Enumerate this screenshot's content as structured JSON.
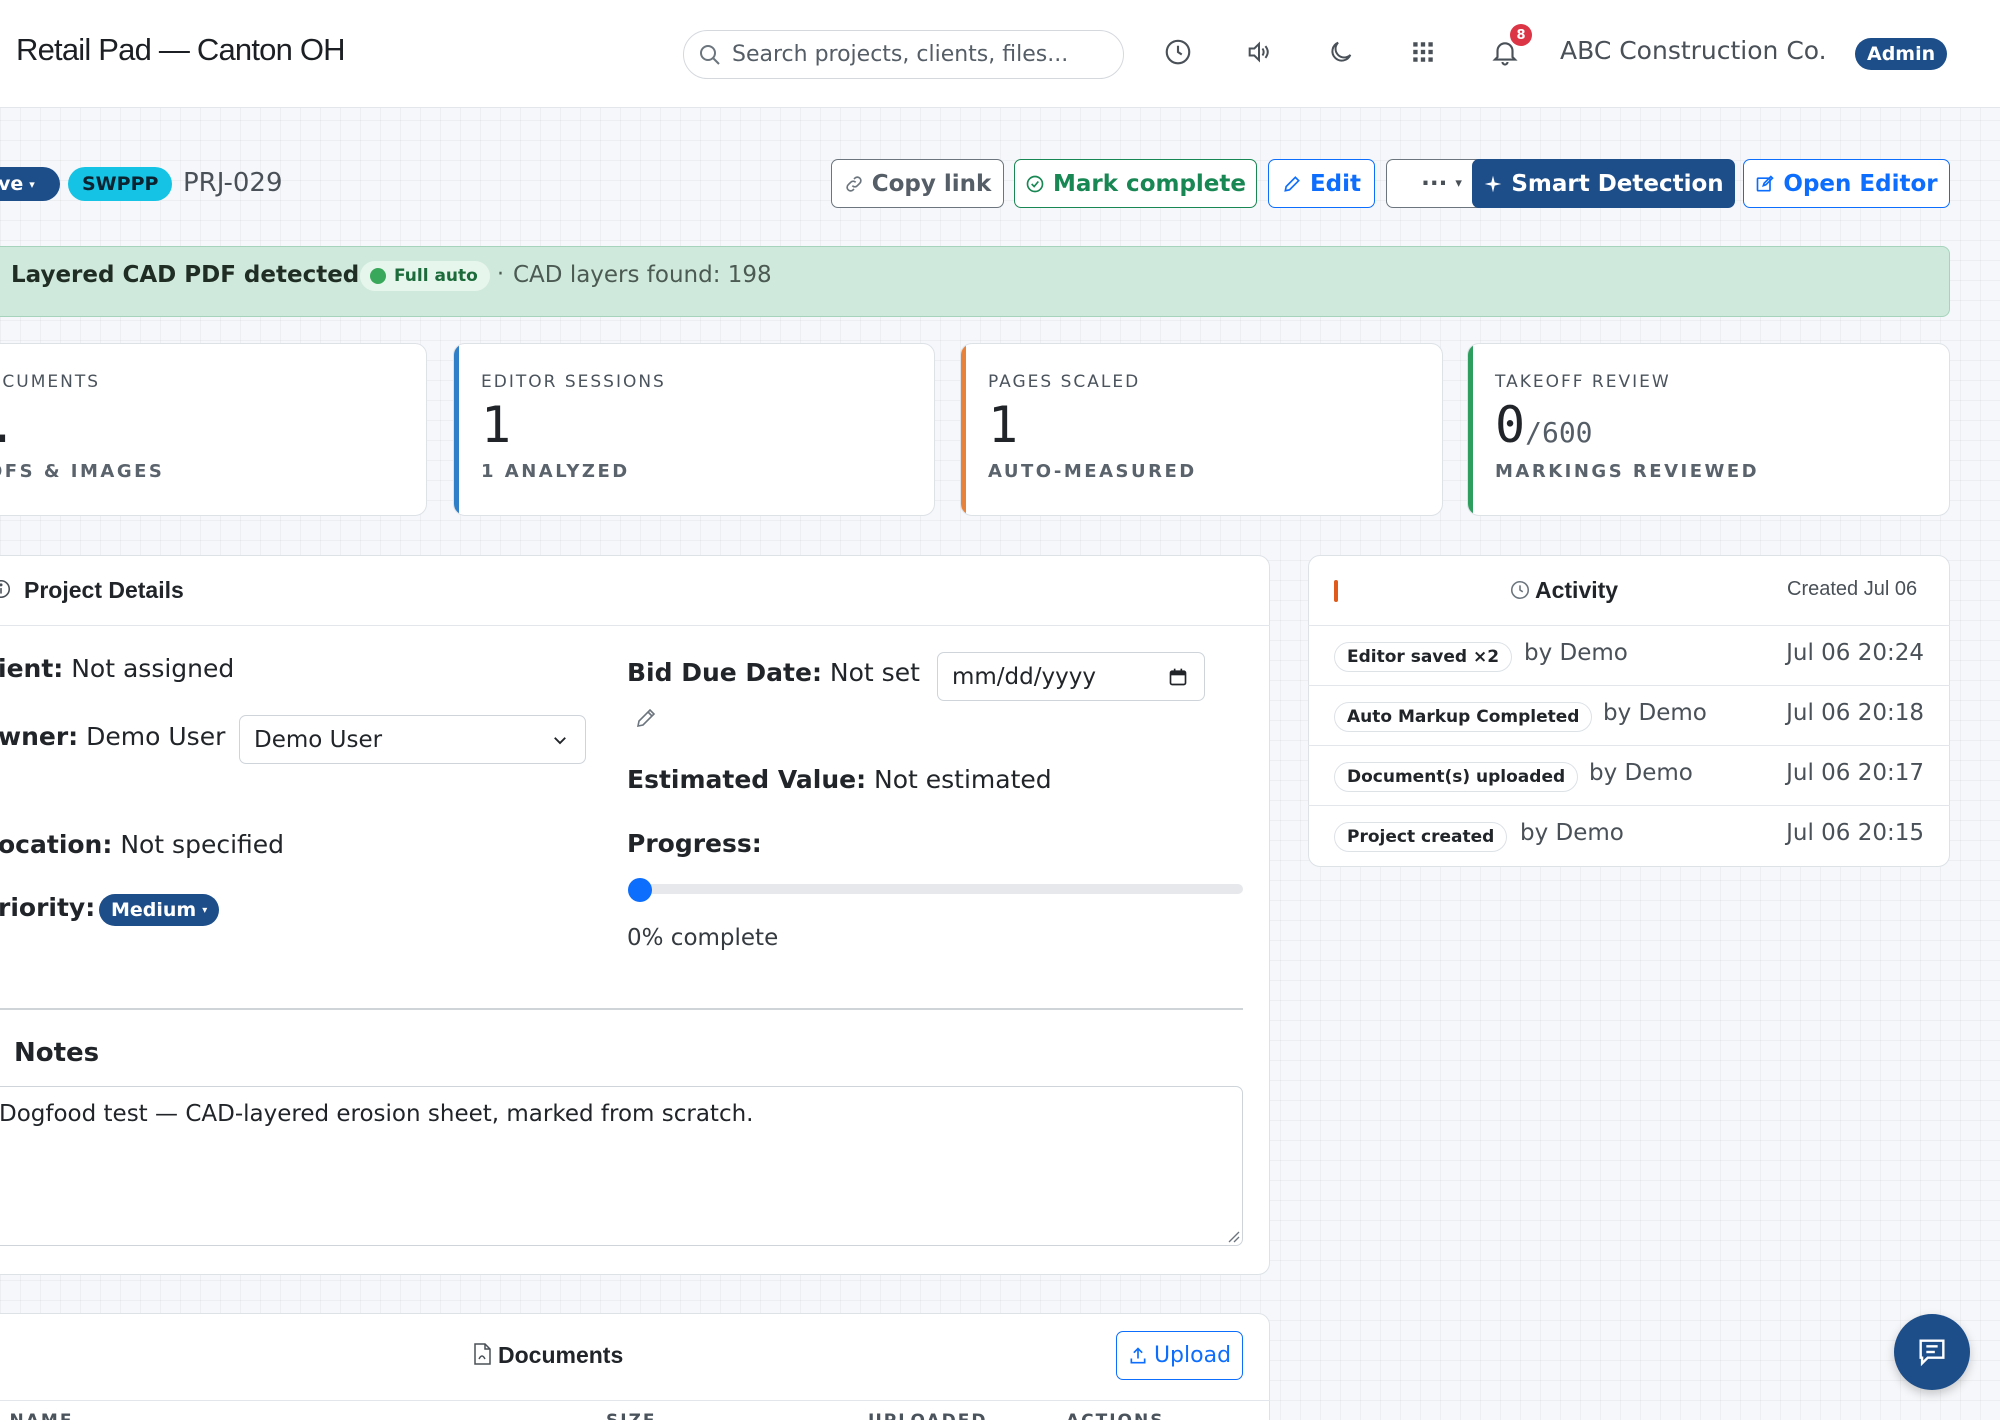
{
  "app": {
    "title": "Retail Pad — Canton OH",
    "search_placeholder": "Search projects, clients, files...",
    "notification_count": "8",
    "company": "ABC Construction Co.",
    "role_badge": "Admin"
  },
  "header": {
    "status": "ve",
    "type_tag": "SWPPP",
    "project_id": "PRJ-029",
    "buttons": {
      "copy_link": "Copy link",
      "mark_complete": "Mark complete",
      "edit": "Edit",
      "more": "···",
      "smart_detection": "Smart Detection",
      "open_editor": "Open Editor"
    }
  },
  "banner": {
    "title": "Layered CAD PDF detected",
    "mode": "Full auto",
    "separator": "·",
    "layers": "CAD layers found: 198"
  },
  "stats": [
    {
      "label": "OCUMENTS",
      "value": ".",
      "denominator": "",
      "sub": "OFS & IMAGES",
      "accent": "#c9ced4"
    },
    {
      "label": "EDITOR SESSIONS",
      "value": "1",
      "denominator": "",
      "sub": "1 ANALYZED",
      "accent": "#2f7fc8"
    },
    {
      "label": "PAGES SCALED",
      "value": "1",
      "denominator": "",
      "sub": "AUTO-MEASURED",
      "accent": "#e8823a"
    },
    {
      "label": "TAKEOFF REVIEW",
      "value": "0",
      "denominator": "/600",
      "sub": "MARKINGS REVIEWED",
      "accent": "#2e9e5e"
    }
  ],
  "details": {
    "title": "Project Details",
    "client_label": "ient:",
    "client_value": "Not assigned",
    "owner_label": "wner:",
    "owner_value": "Demo User",
    "owner_select": "Demo User",
    "location_label": "ocation:",
    "location_value": "Not specified",
    "priority_label": "riority:",
    "priority_value": "Medium",
    "bid_label": "Bid Due Date:",
    "bid_value": "Not set",
    "date_placeholder": "mm/dd/yyyy",
    "est_label": "Estimated Value:",
    "est_value": "Not estimated",
    "progress_label": "Progress:",
    "progress_percent": 0,
    "progress_text": "0% complete",
    "notes_title": "Notes",
    "notes_text": "Dogfood test — CAD-layered erosion sheet, marked from scratch."
  },
  "activity": {
    "title": "Activity",
    "created": "Created Jul 06",
    "items": [
      {
        "tag": "Editor saved ×2",
        "by": "by Demo",
        "time": "Jul 06 20:24"
      },
      {
        "tag": "Auto Markup Completed",
        "by": "by Demo",
        "time": "Jul 06 20:18"
      },
      {
        "tag": "Document(s) uploaded",
        "by": "by Demo",
        "time": "Jul 06 20:17"
      },
      {
        "tag": "Project created",
        "by": "by Demo",
        "time": "Jul 06 20:15"
      }
    ]
  },
  "documents": {
    "title": "Documents",
    "upload": "Upload",
    "columns": [
      "E NAME",
      "SIZE",
      "UPLOADED",
      "ACTIONS"
    ]
  },
  "colors": {
    "brand": "#1d4e89",
    "success": "#198754",
    "primary": "#0d6efd",
    "banner_bg": "#d0e9dd"
  },
  "icons": [
    "search-icon",
    "history-icon",
    "speaker-icon",
    "moon-icon",
    "apps-grid-icon",
    "bell-icon",
    "link-icon",
    "check-circle-icon",
    "pencil-icon",
    "sparkle-icon",
    "edit-square-icon",
    "info-icon",
    "clock-icon",
    "calendar-icon",
    "chevron-down-icon",
    "pdf-file-icon",
    "upload-icon",
    "chat-icon"
  ]
}
